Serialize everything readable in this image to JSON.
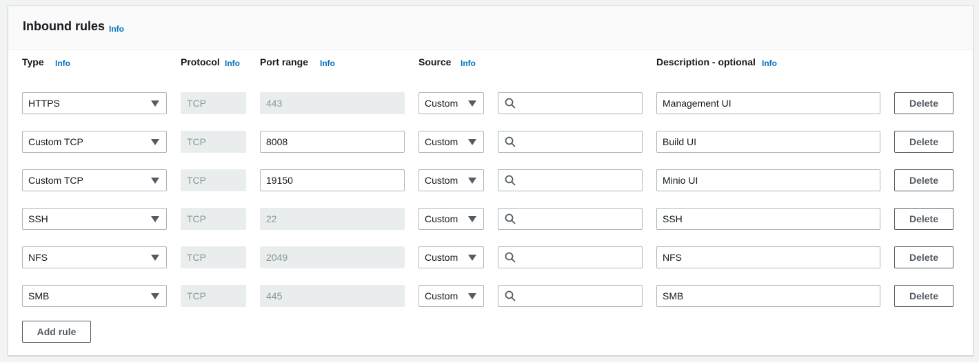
{
  "section": {
    "title": "Inbound rules",
    "info": "Info"
  },
  "columns": {
    "type": "Type",
    "protocol": "Protocol",
    "port_range": "Port range",
    "source": "Source",
    "description": "Description - optional",
    "info": "Info"
  },
  "rules": [
    {
      "type": "HTTPS",
      "protocol": "TCP",
      "port": "443",
      "port_editable": false,
      "source": "Custom",
      "cidr": "",
      "description": "Management UI",
      "delete": "Delete"
    },
    {
      "type": "Custom TCP",
      "protocol": "TCP",
      "port": "8008",
      "port_editable": true,
      "source": "Custom",
      "cidr": "",
      "description": "Build UI",
      "delete": "Delete"
    },
    {
      "type": "Custom TCP",
      "protocol": "TCP",
      "port": "19150",
      "port_editable": true,
      "source": "Custom",
      "cidr": "",
      "description": "Minio UI",
      "delete": "Delete"
    },
    {
      "type": "SSH",
      "protocol": "TCP",
      "port": "22",
      "port_editable": false,
      "source": "Custom",
      "cidr": "",
      "description": "SSH",
      "delete": "Delete"
    },
    {
      "type": "NFS",
      "protocol": "TCP",
      "port": "2049",
      "port_editable": false,
      "source": "Custom",
      "cidr": "",
      "description": "NFS",
      "delete": "Delete"
    },
    {
      "type": "SMB",
      "protocol": "TCP",
      "port": "445",
      "port_editable": false,
      "source": "Custom",
      "cidr": "",
      "description": "SMB",
      "delete": "Delete"
    }
  ],
  "add_rule": "Add rule",
  "icons": {
    "dropdown": "caret-down-icon",
    "search": "search-icon"
  },
  "colors": {
    "link": "#0073bb",
    "disabled_bg": "#eaeded",
    "border": "#aab7b8"
  }
}
